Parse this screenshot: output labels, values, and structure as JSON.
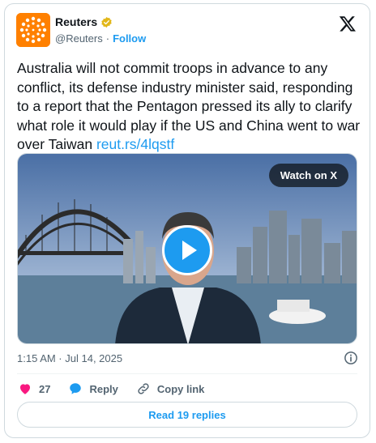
{
  "account": {
    "name": "Reuters",
    "handle": "@Reuters",
    "separator": "·",
    "follow_label": "Follow"
  },
  "tweet": {
    "text": "Australia will not commit troops in advance to any conflict, its defense industry minister said, responding to a report that the Pentagon pressed its ally to clarify what role it would play if the US and China went to war over Taiwan",
    "link": "reut.rs/4lqstf",
    "timestamp": "1:15 AM · Jul 14, 2025"
  },
  "media": {
    "watch_label": "Watch on X"
  },
  "actions": {
    "likes_count": "27",
    "reply_label": "Reply",
    "copy_link_label": "Copy link"
  },
  "read_replies_label": "Read 19 replies",
  "colors": {
    "accent": "#1d9bf0",
    "brand_orange": "#ff8000",
    "like_red": "#f91880",
    "verified_gold": "#e2b719"
  }
}
